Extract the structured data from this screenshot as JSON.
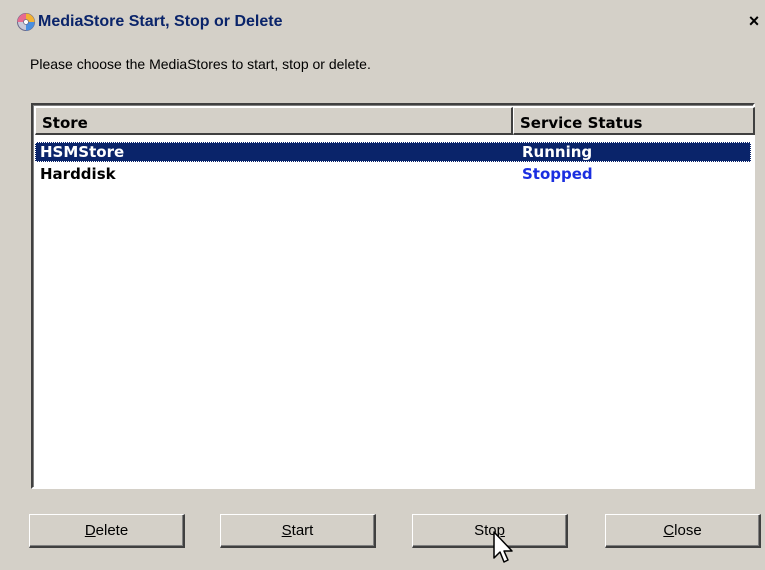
{
  "window": {
    "title": "MediaStore Start, Stop or Delete",
    "close_label": "×"
  },
  "instruction": "Please choose the MediaStores to start, stop or delete.",
  "list": {
    "columns": [
      "Store",
      "Service Status"
    ],
    "rows": [
      {
        "store": "HSMStore",
        "status": "Running",
        "selected": true
      },
      {
        "store": "Harddisk",
        "status": "Stopped",
        "selected": false
      }
    ]
  },
  "buttons": {
    "delete": {
      "mnemonic": "D",
      "rest": "elete"
    },
    "start": {
      "mnemonic": "S",
      "rest": "tart"
    },
    "stop": {
      "lead": "Sto",
      "mnemonic": "p"
    },
    "close": {
      "mnemonic": "C",
      "rest": "lose"
    }
  },
  "colors": {
    "title_text": "#0a246a",
    "selection": "#0a246a",
    "stopped_status": "#1a2ee0",
    "dialog_face": "#d4d0c8"
  }
}
